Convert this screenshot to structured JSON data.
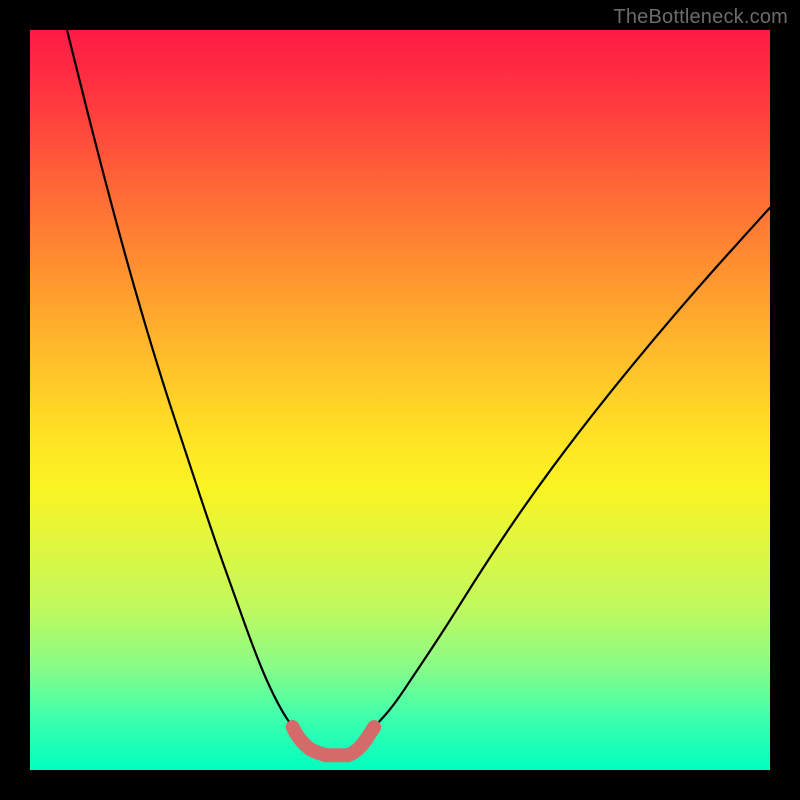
{
  "watermark": {
    "text": "TheBottleneck.com"
  },
  "chart_data": {
    "type": "line",
    "title": "",
    "xlabel": "",
    "ylabel": "",
    "xlim": [
      0,
      1
    ],
    "ylim": [
      0,
      1
    ],
    "grid": false,
    "legend": false,
    "annotations": [],
    "series": [
      {
        "name": "curve-left",
        "color": "#000000",
        "x": [
          0.05,
          0.09,
          0.13,
          0.17,
          0.21,
          0.25,
          0.275,
          0.3,
          0.32,
          0.34,
          0.355
        ],
        "y": [
          1.0,
          0.84,
          0.69,
          0.553,
          0.43,
          0.31,
          0.24,
          0.17,
          0.12,
          0.08,
          0.058
        ]
      },
      {
        "name": "curve-right",
        "color": "#000000",
        "x": [
          0.465,
          0.49,
          0.52,
          0.56,
          0.61,
          0.67,
          0.74,
          0.82,
          0.905,
          1.0
        ],
        "y": [
          0.058,
          0.085,
          0.13,
          0.19,
          0.27,
          0.36,
          0.455,
          0.555,
          0.655,
          0.76
        ]
      },
      {
        "name": "bottom-accent-left",
        "color": "#d46a6a",
        "x": [
          0.355,
          0.36,
          0.37,
          0.38,
          0.39,
          0.4
        ],
        "y": [
          0.058,
          0.048,
          0.035,
          0.027,
          0.023,
          0.02
        ]
      },
      {
        "name": "bottom-flat",
        "color": "#d46a6a",
        "x": [
          0.4,
          0.41,
          0.42,
          0.43
        ],
        "y": [
          0.02,
          0.02,
          0.02,
          0.02
        ]
      },
      {
        "name": "bottom-accent-right",
        "color": "#d46a6a",
        "x": [
          0.43,
          0.44,
          0.45,
          0.458,
          0.465
        ],
        "y": [
          0.02,
          0.025,
          0.035,
          0.047,
          0.058
        ]
      }
    ],
    "background_gradient": {
      "direction": "vertical",
      "stops": [
        {
          "pos": 0.0,
          "color": "#ff1a46"
        },
        {
          "pos": 0.22,
          "color": "#ff6a36"
        },
        {
          "pos": 0.45,
          "color": "#ffc02a"
        },
        {
          "pos": 0.62,
          "color": "#f9f423"
        },
        {
          "pos": 0.86,
          "color": "#8afc87"
        },
        {
          "pos": 1.0,
          "color": "#00ffc0"
        }
      ]
    }
  }
}
